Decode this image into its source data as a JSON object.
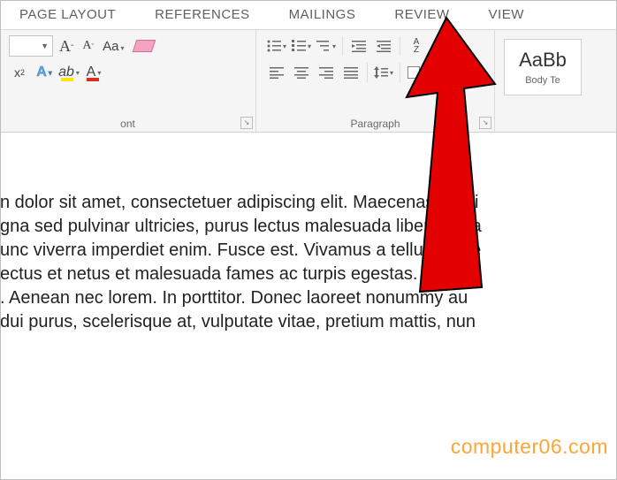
{
  "tabs": {
    "page_layout": "PAGE LAYOUT",
    "references": "REFERENCES",
    "mailings": "MAILINGS",
    "review": "REVIEW",
    "view": "VIEW"
  },
  "ribbon": {
    "font": {
      "group_label": "ont",
      "font_size_value": "",
      "case_label": "Aa",
      "sub_label": "x",
      "sub_sub": "2",
      "outline_label": "A",
      "highlight_label": "ab",
      "fontcolor_label": "A"
    },
    "paragraph": {
      "group_label": "Paragraph",
      "sort_a": "A",
      "sort_z": "Z",
      "pilcrow": "¶"
    },
    "styles": {
      "preview": "AaBb",
      "name": "Body Te"
    }
  },
  "document": {
    "text": "n dolor sit amet, consectetuer adipiscing elit. Maecenas portti\ngna sed pulvinar ultricies, purus lectus malesuada libero, sit a\nunc viverra imperdiet enim. Fusce est. Vivamus a tellus. Pelle\nectus et netus et malesuada fames ac turpis egestas. Proin p\n. Aenean nec lorem. In porttitor. Donec laoreet nonummy au\n dui purus, scelerisque at, vulputate vitae, pretium mattis, nun"
  },
  "watermark": "computer06.com"
}
